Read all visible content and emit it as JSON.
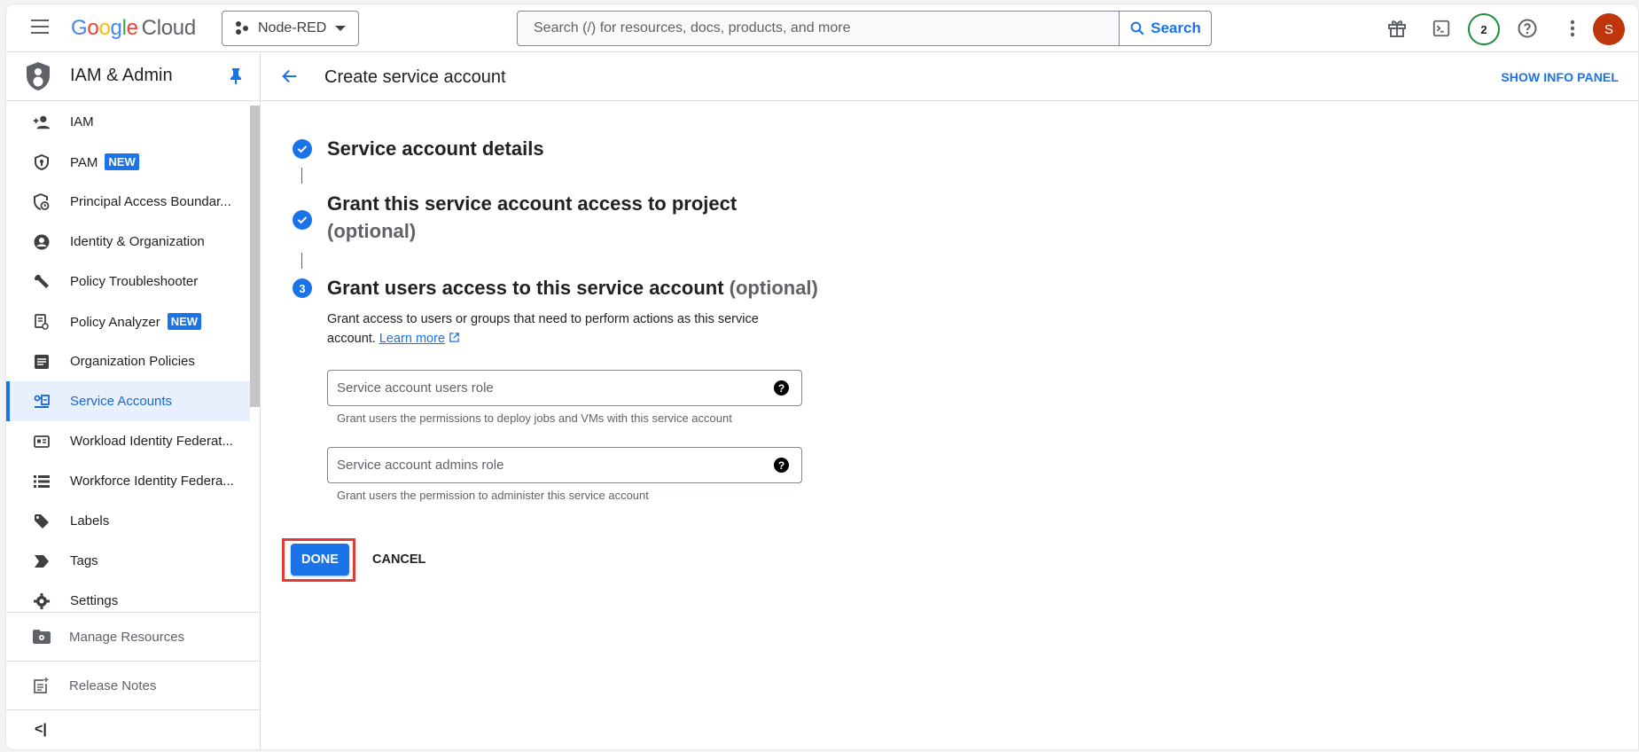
{
  "topbar": {
    "logo": {
      "g": "G",
      "o1": "o",
      "o2": "o",
      "g2": "g",
      "l": "l",
      "e": "e",
      "cloud": "Cloud"
    },
    "project_name": "Node-RED",
    "search_placeholder": "Search (/) for resources, docs, products, and more",
    "search_button": "Search",
    "notification_count": "2",
    "avatar_initial": "S",
    "colors": {
      "accent": "#1a73e8",
      "avatar": "#bf360c",
      "badge_ring": "#1e8e3e"
    }
  },
  "sidebar": {
    "title": "IAM & Admin",
    "items": [
      {
        "label": "IAM",
        "icon": "person-add-icon"
      },
      {
        "label": "PAM",
        "icon": "shield-key-icon",
        "badge": "NEW"
      },
      {
        "label": "Principal Access Boundar...",
        "icon": "shield-clock-icon"
      },
      {
        "label": "Identity & Organization",
        "icon": "account-circle-icon"
      },
      {
        "label": "Policy Troubleshooter",
        "icon": "wrench-icon"
      },
      {
        "label": "Policy Analyzer",
        "icon": "doc-search-icon",
        "badge": "NEW"
      },
      {
        "label": "Organization Policies",
        "icon": "policy-doc-icon"
      },
      {
        "label": "Service Accounts",
        "icon": "service-account-icon",
        "active": true
      },
      {
        "label": "Workload Identity Federat...",
        "icon": "id-card-icon"
      },
      {
        "label": "Workforce Identity Federa...",
        "icon": "list-icon"
      },
      {
        "label": "Labels",
        "icon": "label-icon"
      },
      {
        "label": "Tags",
        "icon": "tag-chevron-icon"
      },
      {
        "label": "Settings",
        "icon": "gear-icon"
      }
    ],
    "bottom": {
      "manage_resources": "Manage Resources",
      "release_notes": "Release Notes",
      "collapse": "<|"
    }
  },
  "page": {
    "title": "Create service account",
    "info_panel": "SHOW INFO PANEL",
    "steps": [
      {
        "title": "Service account details",
        "status": "complete"
      },
      {
        "title": "Grant this service account access to project",
        "optional": "(optional)",
        "status": "complete"
      },
      {
        "number": "3",
        "title": "Grant users access to this service account",
        "optional": "(optional)",
        "status": "active"
      }
    ],
    "description": "Grant access to users or groups that need to perform actions as this service account.",
    "learn_more": "Learn more",
    "fields": [
      {
        "placeholder": "Service account users role",
        "value": "",
        "hint": "Grant users the permissions to deploy jobs and VMs with this service account"
      },
      {
        "placeholder": "Service account admins role",
        "value": "",
        "hint": "Grant users the permission to administer this service account"
      }
    ],
    "done_button": "DONE",
    "cancel_button": "CANCEL"
  }
}
